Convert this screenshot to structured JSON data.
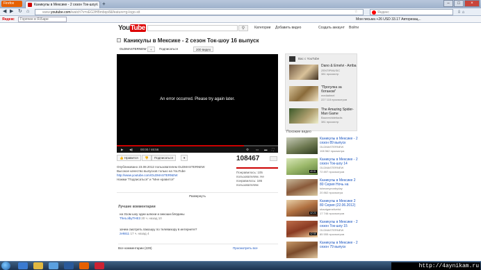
{
  "browser": {
    "menu_label": "Firefox",
    "tab_title": "Каникулы в Мексике - 2 сезон Ток-шоу...",
    "address_www": "www.",
    "address_domain": "youtube.com",
    "address_path": "/watch?v=sEG3HBmbqo8&feature=g-logo-xit",
    "search_placeholder": "Яндекс",
    "yandex_bar_label": "Яндекс",
    "yandex_search_placeholder": "Горячее в Я.Баре",
    "yandex_bar_right": "Мои письма  +26  USD 33.17  Авторизац..."
  },
  "youtube": {
    "logo_you": "You",
    "logo_tube": "Tube",
    "header_links": [
      "Категории",
      "Добавить видео",
      "Создать аккаунт",
      "Войти"
    ],
    "video_title": "Каникулы в Мексике - 2 сезон Ток-шоу 16 выпуск",
    "channel_name": "OLDMASTERNEW",
    "subscribe_label": "Подписаться",
    "video_count_label": "200 видео",
    "error_message": "An error occurred. Please try again later.",
    "time_display": "00:00 / 46:56",
    "like_label": "Нравится",
    "subscribe2_label": "Подписаться",
    "view_count": "108467",
    "progress_played": 0.79,
    "uploader_line": "Опубликовано 23.08.2012 пользователем OLDMASTERNEW",
    "desc_line1": "Высокое качество выпусков только на YouTube",
    "desc_link": "http://www.youtube.com/OLDMASTERNEW",
    "desc_line3": "Нажми \"Подписаться\" и \"Мне нравится\"",
    "likes_text": "Понравилось: 105 пользователям. Не понравилось: 186 пользователям",
    "more_label": "Развернуть",
    "top_comments_label": "Лучшие комментарии",
    "comments": [
      {
        "text": "на 31ом шоу одни шлюхи и анкоши.блядины",
        "user": "TheLolbyTHE3",
        "age": "20 ч. назад",
        "votes": "10"
      },
      {
        "text": "зачем смотреть пакошуу по телевизору в интернете?",
        "user": "zek611",
        "age": "17 ч. назад",
        "votes": "4"
      }
    ],
    "all_comments_label": "Все комментарии (229)",
    "view_all_label": "Просмотреть все",
    "ad_header": "Вас с YouTube",
    "ads": [
      {
        "title": "Dano & Emelvi - Arriba",
        "channel": "ZENTIPMUSIC",
        "views": "381 просмотр"
      },
      {
        "title": "\"Прогулка за ботаном\"",
        "channel": "mediatimel",
        "views": "227 115 просмотров"
      },
      {
        "title": "The Amazing Spider-Man Game",
        "channel": "Bauneshideitadis",
        "views": "381 просмотр"
      }
    ],
    "related_label": "Похожие видео",
    "related": [
      {
        "title": "Каникулы в Мексике - 2 сезон 89 выпуск",
        "channel": "OLDMASTERNEW",
        "views": "108 562 просмотра",
        "duration": ""
      },
      {
        "title": "Каникулы в Мексике - 2 сезон Ток-шоу 14",
        "channel": "OLDMASTERNEW",
        "views": "72 897 просмотров",
        "duration": "40:01"
      },
      {
        "title": "Каникулы в Мексике 2 80 Серия Ночь на",
        "channel": "tobeomyeonbyday",
        "views": "20 862 просмотра",
        "duration": ""
      },
      {
        "title": "Каникулы в Мексике 2 80 Серия (22.06.2012)",
        "channel": "shaotgamelivehd",
        "views": "17 746 просмотров",
        "duration": "42:23"
      },
      {
        "title": "Каникулы в Мексике - 2 сезон Ток-шоу 15",
        "channel": "OLDMASTERNEW",
        "views": "85 555 просмотров",
        "duration": "42:55"
      },
      {
        "title": "Каникулы в Мексике - 2 сезон 79 выпуск",
        "channel": "",
        "views": "",
        "duration": ""
      }
    ]
  },
  "taskbar": {
    "watermark": "http://4aynikam.ru"
  }
}
